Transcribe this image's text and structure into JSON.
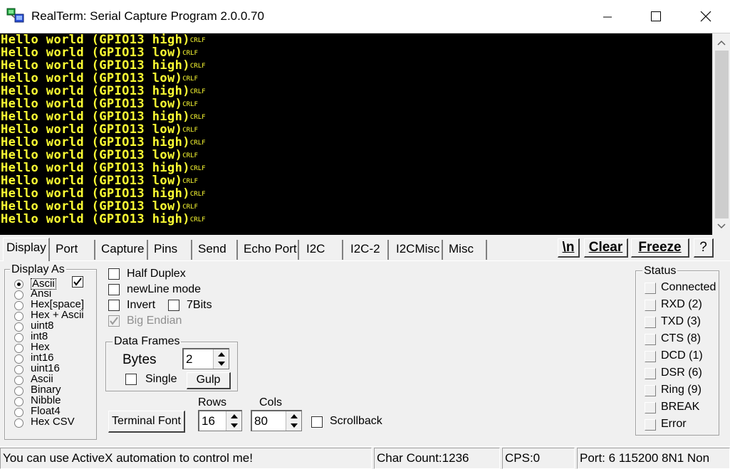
{
  "window": {
    "title": "RealTerm: Serial Capture Program 2.0.0.70"
  },
  "terminal": {
    "crlf": "CRLF",
    "lines": [
      "Hello world (GPIO13 high)",
      "Hello world (GPIO13 low)",
      "Hello world (GPIO13 high)",
      "Hello world (GPIO13 low)",
      "Hello world (GPIO13 high)",
      "Hello world (GPIO13 low)",
      "Hello world (GPIO13 high)",
      "Hello world (GPIO13 low)",
      "Hello world (GPIO13 high)",
      "Hello world (GPIO13 low)",
      "Hello world (GPIO13 high)",
      "Hello world (GPIO13 low)",
      "Hello world (GPIO13 high)",
      "Hello world (GPIO13 low)",
      "Hello world (GPIO13 high)"
    ],
    "text_color": "#ffff33",
    "background": "#000000"
  },
  "tabs": [
    "Display",
    "Port",
    "Capture",
    "Pins",
    "Send",
    "Echo Port",
    "I2C",
    "I2C-2",
    "I2CMisc",
    "Misc"
  ],
  "toolbar": {
    "newline": "\\n",
    "clear": "Clear",
    "freeze": "Freeze",
    "help": "?"
  },
  "display_as": {
    "label": "Display As",
    "options": [
      "Ascii",
      "Ansi",
      "Hex[space]",
      "Hex + Ascii",
      "uint8",
      "int8",
      "Hex",
      "int16",
      "uint16",
      "Ascii",
      "Binary",
      "Nibble",
      "Float4",
      "Hex CSV"
    ],
    "selected": "Ascii"
  },
  "options": {
    "half_duplex": "Half Duplex",
    "newline_mode": "newLine mode",
    "invert": "Invert",
    "seven_bits": "7Bits",
    "big_endian": "Big Endian"
  },
  "data_frames": {
    "label": "Data Frames",
    "bytes_label": "Bytes",
    "bytes_value": "2",
    "single_label": "Single",
    "gulp_label": "Gulp"
  },
  "terminal_font": {
    "button": "Terminal Font",
    "rows_label": "Rows",
    "rows_value": "16",
    "cols_label": "Cols",
    "cols_value": "80",
    "scrollback_label": "Scrollback"
  },
  "status": {
    "label": "Status",
    "items": [
      "Connected",
      "RXD (2)",
      "TXD (3)",
      "CTS (8)",
      "DCD (1)",
      "DSR (6)",
      "Ring (9)",
      "BREAK",
      "Error"
    ]
  },
  "statusbar": {
    "message": "You can use ActiveX automation to control me!",
    "char_count": "Char Count:1236",
    "cps": "CPS:0",
    "port": "Port: 6 115200 8N1 Non"
  }
}
